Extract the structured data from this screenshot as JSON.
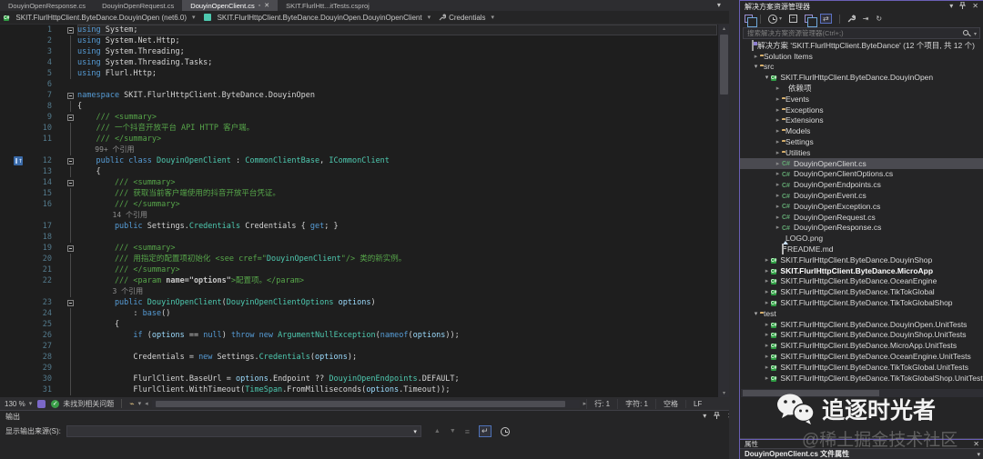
{
  "colors": {
    "editor_bg": "#1e1e1e",
    "chrome_bg": "#2d2d30",
    "panel_bg": "#252526",
    "keyword": "#569cd6",
    "type": "#4ec9b0",
    "comment": "#57a64a",
    "param": "#9cdcfe",
    "plain": "#d4d4d4",
    "codelens": "#8f8f8f",
    "selection_row": "#4a4a50",
    "accent_border": "#6a5fb5",
    "folder": "#d8b06c",
    "project_green": "#2f9e44",
    "check_green": "#3a9e48"
  },
  "icons": {
    "chevron_down": "▾",
    "chevron_right_collapsed": "▸",
    "chevron_down_expanded": "▾",
    "close": "✕",
    "minus": "−",
    "split": "+",
    "gear": "⚙",
    "sync_arrows": "⇄",
    "refresh": "↻",
    "prev": "▲",
    "next": "▼",
    "wordwrap": "↵",
    "check": "✓",
    "left_arrow": "◂",
    "right_arrow": "▸",
    "up_arrow": "▴",
    "down_arrow": "▾",
    "broom": "⌁"
  },
  "tabs": {
    "items": [
      {
        "label": "DouyinOpenResponse.cs",
        "active": false
      },
      {
        "label": "DouyinOpenRequest.cs",
        "active": false
      },
      {
        "label": "DouyinOpenClient.cs",
        "active": true
      },
      {
        "label": "SKIT.FlurlHtt...itTests.csproj",
        "active": false
      }
    ]
  },
  "breadcrumb": {
    "project": "SKIT.FlurlHttpClient.ByteDance.DouyinOpen (net6.0)",
    "type": "SKIT.FlurlHttpClient.ByteDance.DouyinOpen.DouyinOpenClient",
    "member": "Credentials"
  },
  "editor": {
    "lines": [
      {
        "n": "1",
        "f": "m",
        "cur": true,
        "t": [
          [
            "k",
            "using"
          ],
          [
            "p",
            " System;"
          ]
        ]
      },
      {
        "n": "2",
        "f": "b",
        "t": [
          [
            "k",
            "using"
          ],
          [
            "p",
            " System.Net.Http;"
          ]
        ]
      },
      {
        "n": "3",
        "f": "b",
        "t": [
          [
            "k",
            "using"
          ],
          [
            "p",
            " System.Threading;"
          ]
        ]
      },
      {
        "n": "4",
        "f": "b",
        "t": [
          [
            "k",
            "using"
          ],
          [
            "p",
            " System.Threading.Tasks;"
          ]
        ]
      },
      {
        "n": "5",
        "f": "b",
        "t": [
          [
            "k",
            "using"
          ],
          [
            "p",
            " Flurl.Http;"
          ]
        ]
      },
      {
        "n": "6",
        "f": "",
        "t": []
      },
      {
        "n": "7",
        "f": "m",
        "t": [
          [
            "k",
            "namespace"
          ],
          [
            "p",
            " SKIT.FlurlHttpClient.ByteDance.DouyinOpen"
          ]
        ]
      },
      {
        "n": "8",
        "f": "b",
        "t": [
          [
            "p",
            "{"
          ]
        ]
      },
      {
        "n": "9",
        "f": "m",
        "t": [
          [
            "c",
            "    /// <summary>"
          ]
        ]
      },
      {
        "n": "10",
        "f": "b",
        "t": [
          [
            "c",
            "    /// 一个抖音开放平台 API HTTP 客户端。"
          ]
        ]
      },
      {
        "n": "11",
        "f": "b",
        "t": [
          [
            "c",
            "    /// </summary>"
          ]
        ]
      },
      {
        "n": "",
        "f": "b",
        "t": [
          [
            "m",
            "    99+ 个引用"
          ]
        ]
      },
      {
        "n": "12",
        "f": "m",
        "icon": true,
        "t": [
          [
            "k",
            "    public class "
          ],
          [
            "t",
            "DouyinOpenClient"
          ],
          [
            "p",
            " : "
          ],
          [
            "t",
            "CommonClientBase"
          ],
          [
            "p",
            ", "
          ],
          [
            "t",
            "ICommonClient"
          ]
        ]
      },
      {
        "n": "13",
        "f": "b",
        "t": [
          [
            "p",
            "    {"
          ]
        ]
      },
      {
        "n": "14",
        "f": "m",
        "t": [
          [
            "c",
            "        /// <summary>"
          ]
        ]
      },
      {
        "n": "15",
        "f": "b",
        "t": [
          [
            "c",
            "        /// 获取当前客户端使用的抖音开放平台凭证。"
          ]
        ]
      },
      {
        "n": "16",
        "f": "b",
        "t": [
          [
            "c",
            "        /// </summary>"
          ]
        ]
      },
      {
        "n": "",
        "f": "b",
        "t": [
          [
            "m",
            "        14 个引用"
          ]
        ]
      },
      {
        "n": "17",
        "f": "b",
        "t": [
          [
            "k",
            "        public "
          ],
          [
            "p",
            "Settings."
          ],
          [
            "t",
            "Credentials"
          ],
          [
            "p",
            " Credentials { "
          ],
          [
            "k",
            "get"
          ],
          [
            "p",
            "; }"
          ]
        ]
      },
      {
        "n": "18",
        "f": "b",
        "t": []
      },
      {
        "n": "19",
        "f": "m",
        "t": [
          [
            "c",
            "        /// <summary>"
          ]
        ]
      },
      {
        "n": "20",
        "f": "b",
        "t": [
          [
            "c",
            "        /// 用指定的配置项初始化 <see cref=\""
          ],
          [
            "t",
            "DouyinOpenClient"
          ],
          [
            "c",
            "\"/> 类的新实例。"
          ]
        ]
      },
      {
        "n": "21",
        "f": "b",
        "t": [
          [
            "c",
            "        /// </summary>"
          ]
        ]
      },
      {
        "n": "22",
        "f": "b",
        "t": [
          [
            "c",
            "        /// <param "
          ],
          [
            "ca",
            "name=\"options\""
          ],
          [
            "c",
            ">配置项。</param>"
          ]
        ]
      },
      {
        "n": "",
        "f": "b",
        "t": [
          [
            "m",
            "        3 个引用"
          ]
        ]
      },
      {
        "n": "23",
        "f": "m",
        "t": [
          [
            "k",
            "        public "
          ],
          [
            "t",
            "DouyinOpenClient"
          ],
          [
            "p",
            "("
          ],
          [
            "t",
            "DouyinOpenClientOptions"
          ],
          [
            "p",
            " "
          ],
          [
            "pr",
            "options"
          ],
          [
            "p",
            ")"
          ]
        ]
      },
      {
        "n": "24",
        "f": "b",
        "t": [
          [
            "p",
            "            : "
          ],
          [
            "k",
            "base"
          ],
          [
            "p",
            "()"
          ]
        ]
      },
      {
        "n": "25",
        "f": "b",
        "t": [
          [
            "p",
            "        {"
          ]
        ]
      },
      {
        "n": "26",
        "f": "b",
        "t": [
          [
            "k",
            "            if"
          ],
          [
            "p",
            " ("
          ],
          [
            "pr",
            "options"
          ],
          [
            "p",
            " == "
          ],
          [
            "k",
            "null"
          ],
          [
            "p",
            ") "
          ],
          [
            "k",
            "throw"
          ],
          [
            "p",
            " "
          ],
          [
            "k",
            "new"
          ],
          [
            "p",
            " "
          ],
          [
            "t",
            "ArgumentNullException"
          ],
          [
            "p",
            "("
          ],
          [
            "k",
            "nameof"
          ],
          [
            "p",
            "("
          ],
          [
            "pr",
            "options"
          ],
          [
            "p",
            "));"
          ]
        ]
      },
      {
        "n": "27",
        "f": "b",
        "t": []
      },
      {
        "n": "28",
        "f": "b",
        "t": [
          [
            "p",
            "            Credentials = "
          ],
          [
            "k",
            "new"
          ],
          [
            "p",
            " Settings."
          ],
          [
            "t",
            "Credentials"
          ],
          [
            "p",
            "("
          ],
          [
            "pr",
            "options"
          ],
          [
            "p",
            ");"
          ]
        ]
      },
      {
        "n": "29",
        "f": "b",
        "t": []
      },
      {
        "n": "30",
        "f": "b",
        "t": [
          [
            "p",
            "            FlurlClient.BaseUrl = "
          ],
          [
            "pr",
            "options"
          ],
          [
            "p",
            ".Endpoint ?? "
          ],
          [
            "t",
            "DouyinOpenEndpoints"
          ],
          [
            "p",
            ".DEFAULT;"
          ]
        ]
      },
      {
        "n": "31",
        "f": "b",
        "t": [
          [
            "p",
            "            FlurlClient.WithTimeout("
          ],
          [
            "t",
            "TimeSpan"
          ],
          [
            "p",
            ".FromMilliseconds("
          ],
          [
            "pr",
            "options"
          ],
          [
            "p",
            ".Timeout));"
          ]
        ]
      }
    ]
  },
  "editor_statusbar": {
    "zoom": "130 %",
    "issues": "未找到相关问题",
    "line": "行: 1",
    "column": "字符: 1",
    "spaces": "空格",
    "eol": "LF"
  },
  "output": {
    "title": "输出",
    "source_label": "显示输出来源(S):",
    "source_value": ""
  },
  "solution_explorer": {
    "title": "解决方案资源管理器",
    "search_placeholder": "搜索解决方案资源管理器(Ctrl+;)",
    "tree": [
      {
        "label": "解决方案 'SKIT.FlurlHttpClient.ByteDance' (12 个项目, 共 12 个)",
        "level": 0,
        "icon": "sln",
        "exp": null
      },
      {
        "label": "Solution Items",
        "level": 1,
        "icon": "folder",
        "exp": false
      },
      {
        "label": "src",
        "level": 1,
        "icon": "folder",
        "exp": true
      },
      {
        "label": "SKIT.FlurlHttpClient.ByteDance.DouyinOpen",
        "level": 2,
        "icon": "proj",
        "exp": true
      },
      {
        "label": "依赖项",
        "level": 3,
        "icon": "deps",
        "exp": false
      },
      {
        "label": "Events",
        "level": 3,
        "icon": "folder",
        "exp": false
      },
      {
        "label": "Exceptions",
        "level": 3,
        "icon": "folder",
        "exp": false
      },
      {
        "label": "Extensions",
        "level": 3,
        "icon": "folder",
        "exp": false
      },
      {
        "label": "Models",
        "level": 3,
        "icon": "folder",
        "exp": false
      },
      {
        "label": "Settings",
        "level": 3,
        "icon": "folder",
        "exp": false
      },
      {
        "label": "Utilities",
        "level": 3,
        "icon": "folder",
        "exp": false
      },
      {
        "label": "DouyinOpenClient.cs",
        "level": 3,
        "icon": "cs",
        "exp": false,
        "selected": true
      },
      {
        "label": "DouyinOpenClientOptions.cs",
        "level": 3,
        "icon": "cs",
        "exp": false
      },
      {
        "label": "DouyinOpenEndpoints.cs",
        "level": 3,
        "icon": "cs",
        "exp": false
      },
      {
        "label": "DouyinOpenEvent.cs",
        "level": 3,
        "icon": "cs",
        "exp": false
      },
      {
        "label": "DouyinOpenException.cs",
        "level": 3,
        "icon": "cs",
        "exp": false
      },
      {
        "label": "DouyinOpenRequest.cs",
        "level": 3,
        "icon": "cs",
        "exp": false
      },
      {
        "label": "DouyinOpenResponse.cs",
        "level": 3,
        "icon": "cs",
        "exp": false
      },
      {
        "label": "LOGO.png",
        "level": 3,
        "icon": "img",
        "exp": null
      },
      {
        "label": "README.md",
        "level": 3,
        "icon": "md",
        "exp": null
      },
      {
        "label": "SKIT.FlurlHttpClient.ByteDance.DouyinShop",
        "level": 2,
        "icon": "proj",
        "exp": false
      },
      {
        "label": "SKIT.FlurlHttpClient.ByteDance.MicroApp",
        "level": 2,
        "icon": "proj",
        "exp": false,
        "bold": true
      },
      {
        "label": "SKIT.FlurlHttpClient.ByteDance.OceanEngine",
        "level": 2,
        "icon": "proj",
        "exp": false
      },
      {
        "label": "SKIT.FlurlHttpClient.ByteDance.TikTokGlobal",
        "level": 2,
        "icon": "proj",
        "exp": false
      },
      {
        "label": "SKIT.FlurlHttpClient.ByteDance.TikTokGlobalShop",
        "level": 2,
        "icon": "proj",
        "exp": false
      },
      {
        "label": "test",
        "level": 1,
        "icon": "folder",
        "exp": true
      },
      {
        "label": "SKIT.FlurlHttpClient.ByteDance.DouyinOpen.UnitTests",
        "level": 2,
        "icon": "proj",
        "exp": false
      },
      {
        "label": "SKIT.FlurlHttpClient.ByteDance.DouyinShop.UnitTests",
        "level": 2,
        "icon": "proj",
        "exp": false
      },
      {
        "label": "SKIT.FlurlHttpClient.ByteDance.MicroApp.UnitTests",
        "level": 2,
        "icon": "proj",
        "exp": false
      },
      {
        "label": "SKIT.FlurlHttpClient.ByteDance.OceanEngine.UnitTests",
        "level": 2,
        "icon": "proj",
        "exp": false
      },
      {
        "label": "SKIT.FlurlHttpClient.ByteDance.TikTokGlobal.UnitTests",
        "level": 2,
        "icon": "proj",
        "exp": false
      },
      {
        "label": "SKIT.FlurlHttpClient.ByteDance.TikTokGlobalShop.UnitTests",
        "level": 2,
        "icon": "proj",
        "exp": false
      }
    ]
  },
  "properties": {
    "title": "属性",
    "selection": "DouyinOpenClient.cs 文件属性"
  },
  "watermark": {
    "title": "追逐时光者",
    "subtitle": "@稀土掘金技术社区"
  }
}
